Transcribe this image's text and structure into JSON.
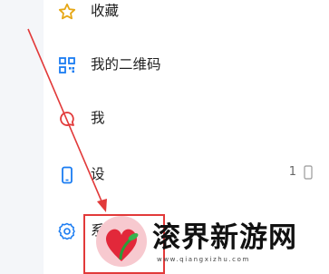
{
  "menu": {
    "favorites": {
      "label": "收藏",
      "icon": "star-icon"
    },
    "qrcode": {
      "label": "我的二维码",
      "icon": "qrcode-icon"
    },
    "me": {
      "label": "我",
      "icon": "chat-bubble-icon"
    },
    "device": {
      "label": "设",
      "icon": "phone-icon",
      "value": "1"
    },
    "system": {
      "label": "系",
      "icon": "gear-icon"
    }
  },
  "watermark": {
    "text": "滚界新游网",
    "url": "www.qiangxizhu.com"
  },
  "colors": {
    "accent": "#1a7cf2",
    "annotation": "#e23a3a"
  }
}
